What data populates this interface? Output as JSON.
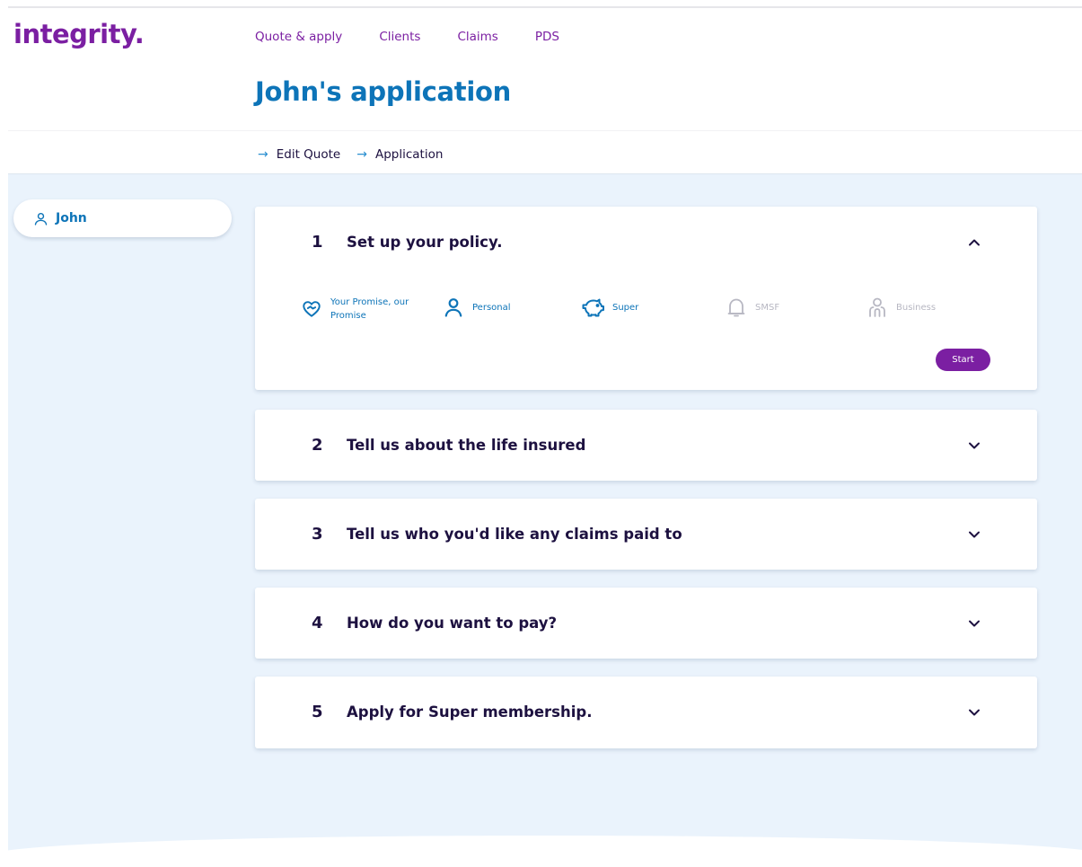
{
  "brand": {
    "logo": "integrity."
  },
  "nav": {
    "items": [
      "Quote & apply",
      "Clients",
      "Claims",
      "PDS"
    ]
  },
  "page": {
    "title": "John's application"
  },
  "breadcrumb": {
    "items": [
      "Edit Quote",
      "Application"
    ]
  },
  "sidebar": {
    "person_name": "John"
  },
  "steps": [
    {
      "number": "1",
      "title": "Set up your policy.",
      "expanded": true
    },
    {
      "number": "2",
      "title": "Tell us about the life insured",
      "expanded": false
    },
    {
      "number": "3",
      "title": "Tell us who you'd like any claims paid to",
      "expanded": false
    },
    {
      "number": "4",
      "title": "How do you want to pay?",
      "expanded": false
    },
    {
      "number": "5",
      "title": "Apply for Super membership.",
      "expanded": false
    }
  ],
  "policy_options": [
    {
      "label_line1": "Your Promise, our",
      "label_line2": "Promise",
      "icon": "heart-handshake-icon",
      "enabled": true
    },
    {
      "label": "Personal",
      "icon": "person-icon",
      "enabled": true
    },
    {
      "label": "Super",
      "icon": "piggy-bank-icon",
      "enabled": true
    },
    {
      "label": "SMSF",
      "icon": "bell-icon",
      "enabled": false
    },
    {
      "label": "Business",
      "icon": "people-icon",
      "enabled": false
    }
  ],
  "actions": {
    "start_label": "Start"
  },
  "colors": {
    "brand_purple": "#7b1fa2",
    "brand_blue": "#0d74b8",
    "background": "#eaf3fc",
    "heading_dark": "#1d1140",
    "disabled": "#b7b7c2"
  }
}
